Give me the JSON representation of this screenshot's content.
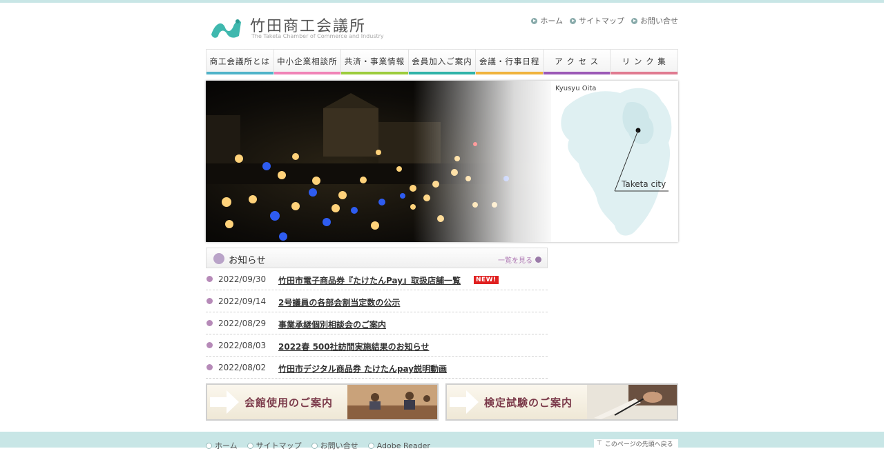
{
  "header": {
    "title": "竹田商工会議所",
    "subtitle": "The Taketa Chamber of Commerce and Industry",
    "links": [
      "ホーム",
      "サイトマップ",
      "お問い合せ"
    ]
  },
  "nav": {
    "items": [
      {
        "label": "商工会議所とは",
        "color": "#4fb3c9"
      },
      {
        "label": "中小企業相談所",
        "color": "#f083b7"
      },
      {
        "label": "共済・事業情報",
        "color": "#9ccc3c"
      },
      {
        "label": "会員加入ご案内",
        "color": "#2fb3a8"
      },
      {
        "label": "会議・行事日程",
        "color": "#f0b33c"
      },
      {
        "label": "ア ク セ ス",
        "color": "#9b59b6"
      },
      {
        "label": "リ ン ク 集",
        "color": "#e07a90"
      }
    ]
  },
  "hero": {
    "map_label": "Kyusyu Oita",
    "city_label": "Taketa city"
  },
  "news": {
    "title": "お知らせ",
    "more": "一覧を見る",
    "items": [
      {
        "date": "2022/09/30",
        "title": "竹田市電子商品券『たけたんPay』取扱店舗一覧",
        "new": "NEW!"
      },
      {
        "date": "2022/09/14",
        "title": "2号議員の各部会割当定数の公示"
      },
      {
        "date": "2022/08/29",
        "title": "事業承継個別相談会のご案内"
      },
      {
        "date": "2022/08/03",
        "title": "2022春 500社訪問実施結果のお知らせ"
      },
      {
        "date": "2022/08/02",
        "title": "竹田市デジタル商品券 たけたんpay説明動画"
      }
    ]
  },
  "banners": {
    "hall": "会館使用のご案内",
    "exam": "検定試験のご案内"
  },
  "footer": {
    "links": [
      "ホーム",
      "サイトマップ",
      "お問い合せ",
      "Adobe Reader"
    ],
    "to_top": "このページの先頭へ戻る"
  }
}
